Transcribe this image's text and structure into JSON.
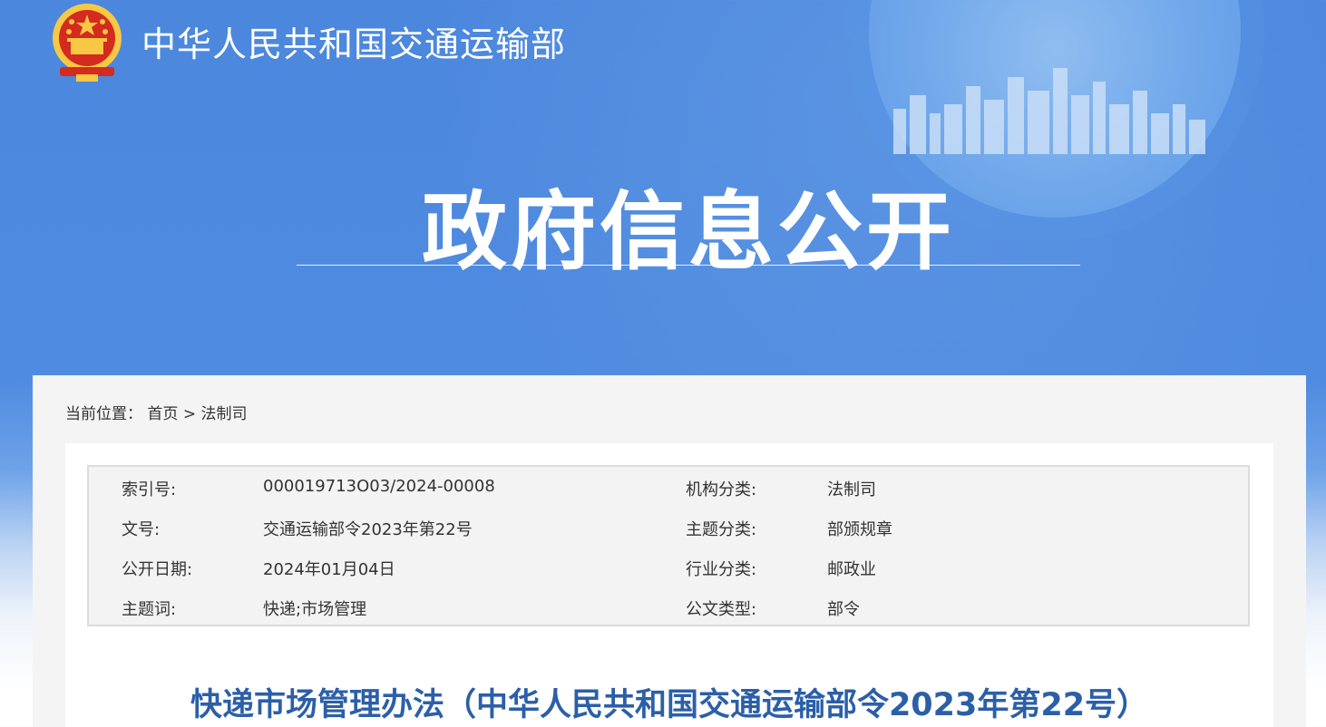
{
  "header": {
    "ministry_name": "中华人民共和国交通运输部",
    "page_heading": "政府信息公开"
  },
  "breadcrumb": {
    "prefix": "当前位置：",
    "items": [
      "首页",
      "法制司"
    ],
    "separator": ">"
  },
  "meta": {
    "rows": [
      {
        "label1": "索引号:",
        "value1": "000019713O03/2024-00008",
        "label2": "机构分类:",
        "value2": "法制司"
      },
      {
        "label1": "文号:",
        "value1": "交通运输部令2023年第22号",
        "label2": "主题分类:",
        "value2": "部颁规章"
      },
      {
        "label1": "公开日期:",
        "value1": "2024年01月04日",
        "label2": "行业分类:",
        "value2": "邮政业"
      },
      {
        "label1": "主题词:",
        "value1": "快递;市场管理",
        "label2": "公文类型:",
        "value2": "部令"
      }
    ]
  },
  "article": {
    "title": "快递市场管理办法（中华人民共和国交通运输部令2023年第22号）"
  },
  "colors": {
    "banner_blue": "#4b87dd",
    "title_blue": "#2b5fa8",
    "emblem_red": "#d42a1f",
    "emblem_gold": "#f6c843"
  },
  "icons": {
    "emblem": "national-emblem-icon",
    "skyline": "city-skyline-icon"
  }
}
